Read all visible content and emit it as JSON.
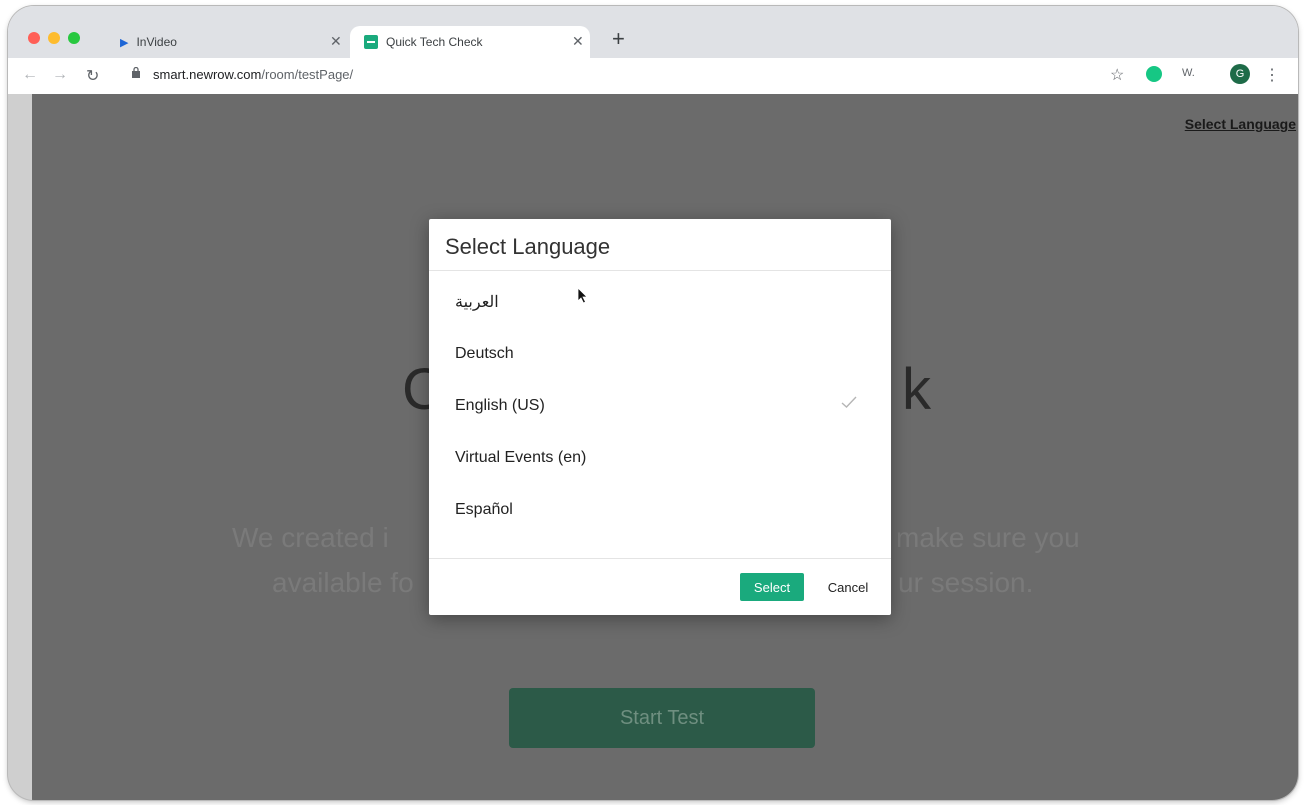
{
  "browser": {
    "tabs": [
      {
        "title": "InVideo",
        "active": false,
        "icon": "invideo-play-icon"
      },
      {
        "title": "Quick Tech Check",
        "active": true,
        "icon": "newrow-favicon-icon"
      }
    ],
    "address": {
      "host": "smart.newrow.com",
      "path": "/room/testPage/"
    },
    "toolbar": {
      "extension_label": "W.",
      "profile_initial": "G"
    }
  },
  "page": {
    "select_language_link": "Select Language",
    "title_left": "C",
    "title_right": "k",
    "subtitle_left": "We created i",
    "subtitle_right": "make sure you",
    "subtitle2_left": "available fo",
    "subtitle2_right": "ur session.",
    "start_button": "Start Test"
  },
  "modal": {
    "title": "Select Language",
    "languages": [
      {
        "label": "العربية",
        "selected": false
      },
      {
        "label": "Deutsch",
        "selected": false
      },
      {
        "label": "English (US)",
        "selected": true
      },
      {
        "label": "Virtual Events (en)",
        "selected": false
      },
      {
        "label": "Español",
        "selected": false
      }
    ],
    "select_button": "Select",
    "cancel_button": "Cancel"
  },
  "colors": {
    "accent": "#1aaa7d",
    "overlay": "#6b6b6b",
    "start_button_bg": "#2c5a48"
  }
}
